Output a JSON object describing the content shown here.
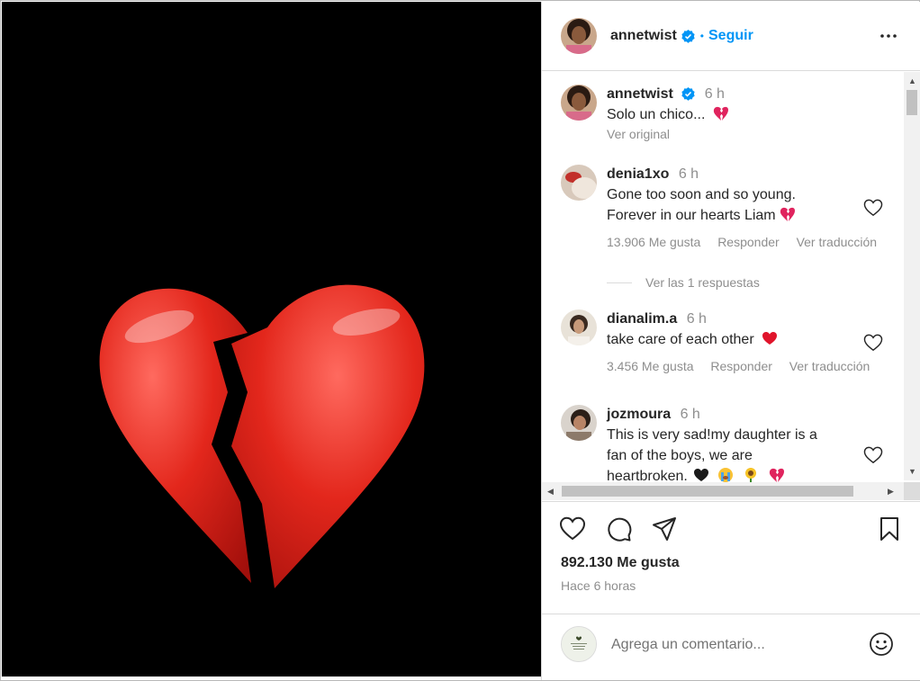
{
  "post": {
    "author": "annetwist",
    "follow_label": "Seguir",
    "dot": "•"
  },
  "caption": {
    "user": "annetwist",
    "time": "6 h",
    "text": "Solo un chico...",
    "see_original": "Ver original"
  },
  "comments": [
    {
      "user": "denia1xo",
      "time": "6 h",
      "lines": [
        "Gone too soon and so young.",
        "Forever in our hearts Liam"
      ],
      "emoji": "broken-heart-emoji",
      "likes": "13.906 Me gusta",
      "reply": "Responder",
      "translate": "Ver traducción",
      "replies_label": "Ver las 1 respuestas"
    },
    {
      "user": "dianalim.a",
      "time": "6 h",
      "lines": [
        "take care of each other"
      ],
      "emoji": "red-heart-emoji",
      "likes": "3.456 Me gusta",
      "reply": "Responder",
      "translate": "Ver traducción"
    },
    {
      "user": "jozmoura",
      "time": "6 h",
      "lines": [
        "This is very sad!my daughter is a",
        "fan of the boys, we are",
        "heartbroken."
      ],
      "emoji": [
        "black-heart-emoji",
        "crying-face-emoji",
        "sunflower-emoji",
        "broken-heart-emoji"
      ]
    }
  ],
  "actions": {
    "likes": "892.130 Me gusta",
    "time_ago": "Hace 6 horas",
    "icons": [
      "heart-icon",
      "comment-icon",
      "share-icon",
      "bookmark-icon"
    ]
  },
  "add_comment": {
    "placeholder": "Agrega un comentario..."
  },
  "colors": {
    "accent": "#0095f6",
    "text": "#262626",
    "secondary": "#8e8e8e",
    "heart_red": "#e0251b"
  }
}
